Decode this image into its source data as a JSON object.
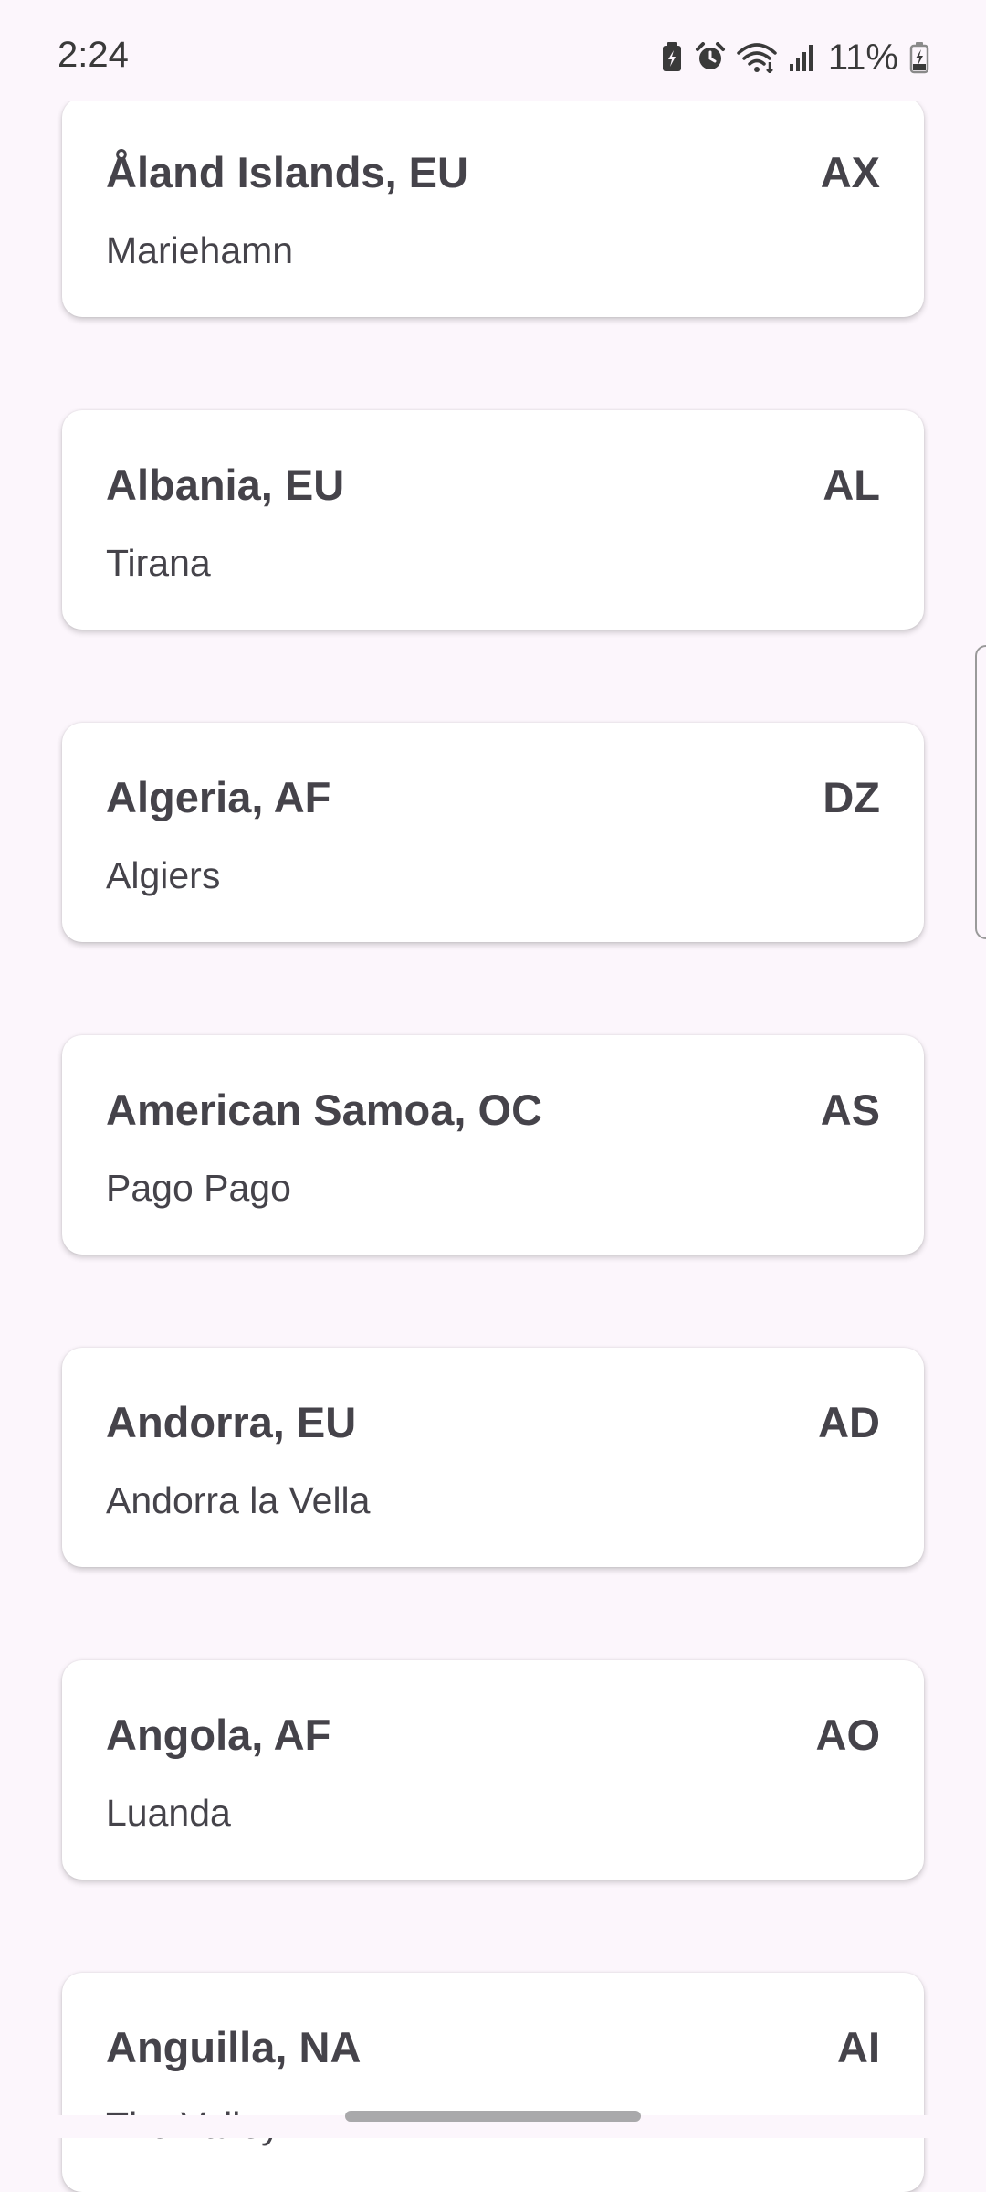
{
  "status_bar": {
    "time": "2:24",
    "battery": "11%",
    "icons": [
      "battery-saver-icon",
      "alarm-icon",
      "wifi-icon",
      "signal-icon",
      "battery-charging-icon"
    ]
  },
  "countries": [
    {
      "name": "Åland Islands, EU",
      "code": "AX",
      "capital": "Mariehamn"
    },
    {
      "name": "Albania, EU",
      "code": "AL",
      "capital": "Tirana"
    },
    {
      "name": "Algeria, AF",
      "code": "DZ",
      "capital": "Algiers"
    },
    {
      "name": "American Samoa, OC",
      "code": "AS",
      "capital": "Pago Pago"
    },
    {
      "name": "Andorra, EU",
      "code": "AD",
      "capital": "Andorra la Vella"
    },
    {
      "name": "Angola, AF",
      "code": "AO",
      "capital": "Luanda"
    },
    {
      "name": "Anguilla, NA",
      "code": "AI",
      "capital": "The Valley"
    }
  ],
  "colors": {
    "background": "#fcf6fc",
    "card": "#ffffff",
    "text": "#45434a"
  }
}
